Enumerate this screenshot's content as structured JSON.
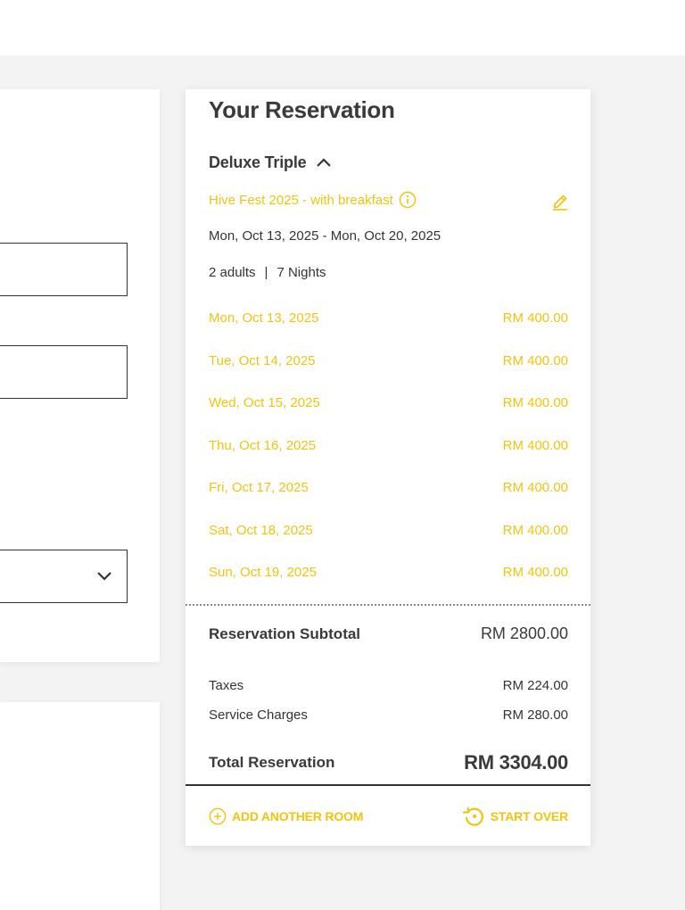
{
  "colors": {
    "accent": "#f2c40f",
    "text": "#3a3a3a",
    "background": "#f3f3f3"
  },
  "reservation": {
    "title": "Your Reservation",
    "room_name": "Deluxe Triple",
    "rate_name": "Hive Fest 2025 - with breakfast",
    "date_range": "Mon, Oct 13, 2025 - Mon, Oct 20, 2025",
    "adults": "2 adults",
    "separator": "|",
    "nights_label": "7 Nights",
    "nights": [
      {
        "date": "Mon, Oct 13, 2025",
        "price": "RM 400.00"
      },
      {
        "date": "Tue, Oct 14, 2025",
        "price": "RM 400.00"
      },
      {
        "date": "Wed, Oct 15, 2025",
        "price": "RM 400.00"
      },
      {
        "date": "Thu, Oct 16, 2025",
        "price": "RM 400.00"
      },
      {
        "date": "Fri, Oct 17, 2025",
        "price": "RM 400.00"
      },
      {
        "date": "Sat, Oct 18, 2025",
        "price": "RM 400.00"
      },
      {
        "date": "Sun, Oct 19, 2025",
        "price": "RM 400.00"
      }
    ],
    "subtotal_label": "Reservation Subtotal",
    "subtotal_value": "RM 2800.00",
    "taxes_label": "Taxes",
    "taxes_value": "RM 224.00",
    "service_label": "Service Charges",
    "service_value": "RM 280.00",
    "total_label": "Total Reservation",
    "total_value": "RM 3304.00",
    "add_room_label": "ADD ANOTHER ROOM",
    "start_over_label": "START OVER"
  },
  "icons": {
    "room_toggle": "chevron-up-icon",
    "rate_info": "info-icon",
    "edit": "pencil-icon",
    "add_room": "plus-circle-icon",
    "start_over": "restart-icon",
    "select": "chevron-down-icon"
  }
}
